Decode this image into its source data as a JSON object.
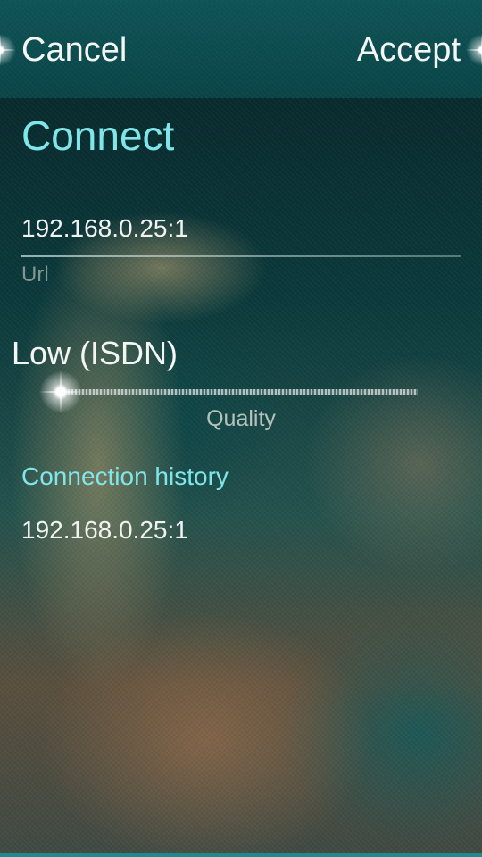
{
  "header": {
    "cancel_label": "Cancel",
    "accept_label": "Accept"
  },
  "page": {
    "title": "Connect"
  },
  "url_field": {
    "value": "192.168.0.25:1",
    "label": "Url"
  },
  "quality_slider": {
    "value_label": "Low (ISDN)",
    "label": "Quality",
    "level": 0
  },
  "history": {
    "section_title": "Connection history",
    "items": [
      {
        "label": "192.168.0.25:1"
      }
    ]
  },
  "colors": {
    "accent": "#7fe6ea",
    "header_bg": "#0f5457",
    "text_primary": "#f1f3f1",
    "bottom_edge": "#1e8a8e"
  }
}
